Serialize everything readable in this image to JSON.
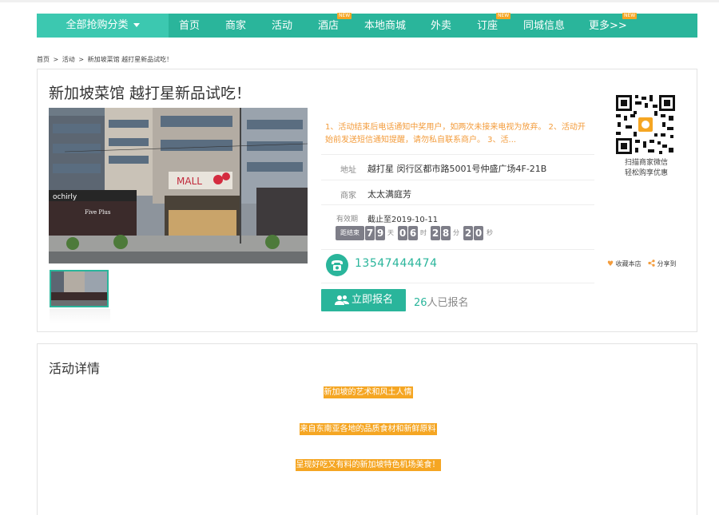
{
  "nav": {
    "category": "全部抢购分类",
    "items": [
      {
        "label": "首页",
        "badge": ""
      },
      {
        "label": "商家",
        "badge": ""
      },
      {
        "label": "活动",
        "badge": ""
      },
      {
        "label": "酒店",
        "badge": "NEW"
      },
      {
        "label": "本地商城",
        "badge": ""
      },
      {
        "label": "外卖",
        "badge": ""
      },
      {
        "label": "订座",
        "badge": "NEW"
      },
      {
        "label": "同城信息",
        "badge": ""
      },
      {
        "label": "更多>>",
        "badge": "NEW"
      }
    ]
  },
  "breadcrumb": [
    "首页",
    ">",
    "活动",
    ">",
    "新加坡菜馆 越打星新品试吃！"
  ],
  "event": {
    "title": "新加坡菜馆 越打星新品试吃！",
    "notice": "1、活动结束后电话通知中奖用户，如两次未接来电视为放弃。 2、活动开始前发送短信通知提醒，请勿私自联系商户。 3、活...",
    "address_label": "地址",
    "address": "越打星 闵行区都市路5001号仲盛广场4F-21B",
    "merchant_label": "商家",
    "merchant": "太太满庭芳",
    "validity_label": "有效期",
    "validity": "截止至2019-10-11",
    "countdown": {
      "label": "距结束",
      "days": [
        "7",
        "9"
      ],
      "days_unit": "天",
      "hours": [
        "0",
        "6"
      ],
      "hours_unit": "时",
      "minutes": [
        "2",
        "8"
      ],
      "minutes_unit": "分",
      "seconds": [
        "2",
        "0"
      ],
      "seconds_unit": "秒"
    },
    "phone": "13547444474",
    "signup_button": "立即报名",
    "signed_count": "26",
    "signed_suffix": "人已报名",
    "qr_caption_1": "扫描商家微信",
    "qr_caption_2": "轻松购享优惠",
    "favorite": "收藏本店",
    "share": "分享到"
  },
  "detail": {
    "title": "活动详情",
    "lines": [
      "新加坡的艺术和风土人情",
      "来自东南亚各地的品质食材和新鲜原料",
      "呈现好吃又有料的新加坡特色机场美食！"
    ]
  },
  "colors": {
    "accent": "#2ab59b",
    "highlight": "#f5a623",
    "notice": "#f39c3c"
  }
}
